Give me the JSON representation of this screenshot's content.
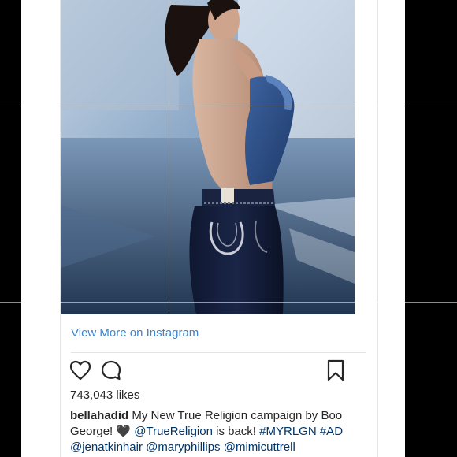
{
  "post": {
    "view_more_label": "View More on Instagram",
    "likes": "743,043 likes",
    "caption": {
      "username": "bellahadid",
      "text1": " My New True Religion campaign by Boo George! ",
      "heart_emoji": "🖤",
      "mention1": "@TrueReligion",
      "text2": " is back! ",
      "hashtag1": "#MYRLGN",
      "hashtag2": "#AD",
      "mention2": "@jenatkinhair",
      "mention3": "@maryphillips",
      "mention4": "@mimicuttrell"
    }
  },
  "icons": {
    "like": "heart-outline-icon",
    "comment": "comment-bubble-icon",
    "save": "bookmark-icon"
  },
  "colors": {
    "link": "#3f84c9",
    "mention": "#003569",
    "text": "#262626"
  }
}
